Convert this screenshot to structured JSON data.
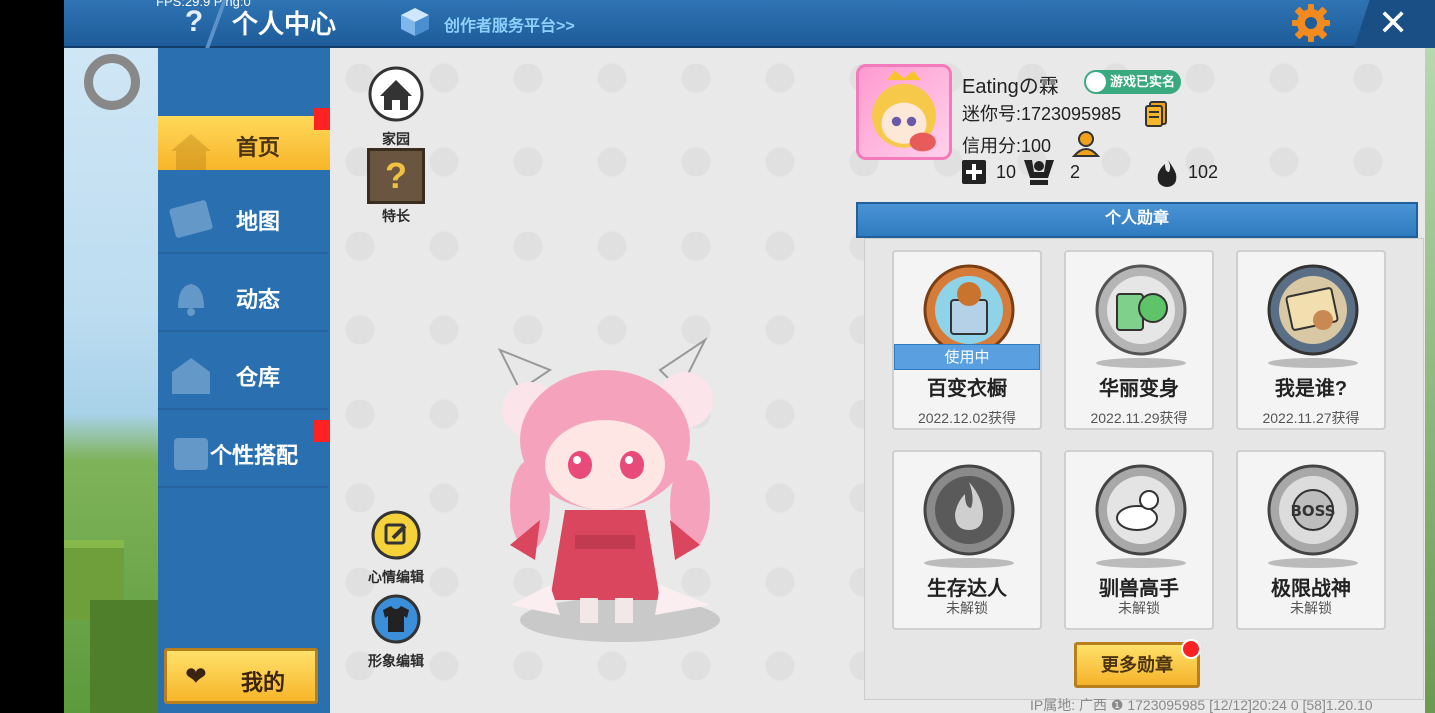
{
  "topbar": {
    "fps": "FPS:29.9  Ping:0",
    "help": "?",
    "title": "个人中心",
    "creator": "创作者服务平台>>",
    "close": "✕"
  },
  "sidebar": {
    "items": [
      {
        "label": "首页"
      },
      {
        "label": "地图"
      },
      {
        "label": "动态"
      },
      {
        "label": "仓库"
      },
      {
        "label": "个性搭配"
      }
    ],
    "mine": "我的",
    "heart": "❤"
  },
  "shortcuts": {
    "home": "家园",
    "talent": "特长",
    "talent_mark": "?",
    "mood": "心情编辑",
    "look": "形象编辑"
  },
  "profile": {
    "name": "Eatingの霖",
    "verified": "游戏已实名",
    "mini_id": "迷你号:1723095985",
    "credit": "信用分:100",
    "stat1": "10",
    "stat2": "2",
    "stat3": "102"
  },
  "medals": {
    "header": "个人勋章",
    "items": [
      {
        "name": "百变衣橱",
        "date": "2022.12.02获得",
        "status": "使用中"
      },
      {
        "name": "华丽变身",
        "date": "2022.11.29获得"
      },
      {
        "name": "我是谁?",
        "date": "2022.11.27获得"
      },
      {
        "name": "生存达人",
        "date": "未解锁"
      },
      {
        "name": "驯兽高手",
        "date": "未解锁"
      },
      {
        "name": "极限战神",
        "date": "未解锁"
      }
    ],
    "more": "更多勋章"
  },
  "footer": "IP属地: 广西 ❶   1723095985   [12/12]20:24 0  [58]1.20.10"
}
